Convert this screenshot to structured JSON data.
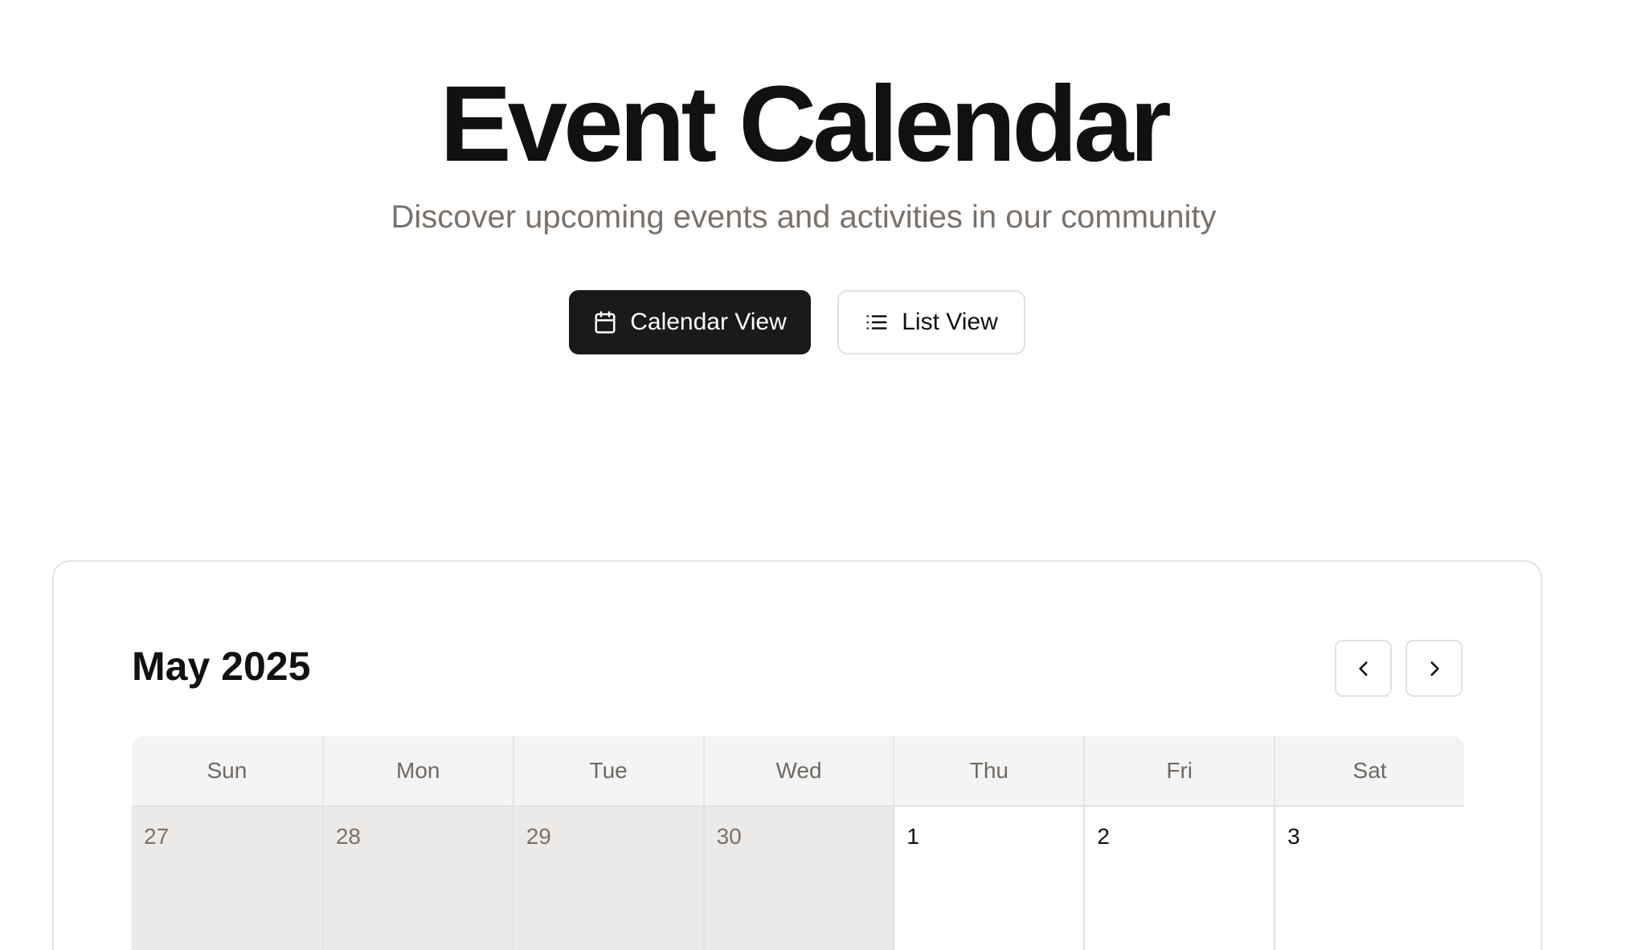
{
  "header": {
    "title": "Event Calendar",
    "subtitle": "Discover upcoming events and activities in our community"
  },
  "view_toggle": {
    "calendar_label": "Calendar View",
    "calendar_icon": "calendar-icon",
    "list_label": "List View",
    "list_icon": "list-icon",
    "active": "calendar"
  },
  "calendar": {
    "month_label": "May 2025",
    "prev_icon": "chevron-left-icon",
    "next_icon": "chevron-right-icon",
    "weekdays": [
      "Sun",
      "Mon",
      "Tue",
      "Wed",
      "Thu",
      "Fri",
      "Sat"
    ],
    "weeks": [
      [
        {
          "day": "27",
          "outside": true
        },
        {
          "day": "28",
          "outside": true
        },
        {
          "day": "29",
          "outside": true
        },
        {
          "day": "30",
          "outside": true
        },
        {
          "day": "1",
          "outside": false
        },
        {
          "day": "2",
          "outside": false
        },
        {
          "day": "3",
          "outside": false
        }
      ]
    ]
  },
  "colors": {
    "primary_button": "#1a1a1a",
    "muted_text": "#7a716a",
    "header_bg": "#f4f4f4",
    "outside_day_bg": "#ebeae8",
    "border": "#e4e2df"
  }
}
